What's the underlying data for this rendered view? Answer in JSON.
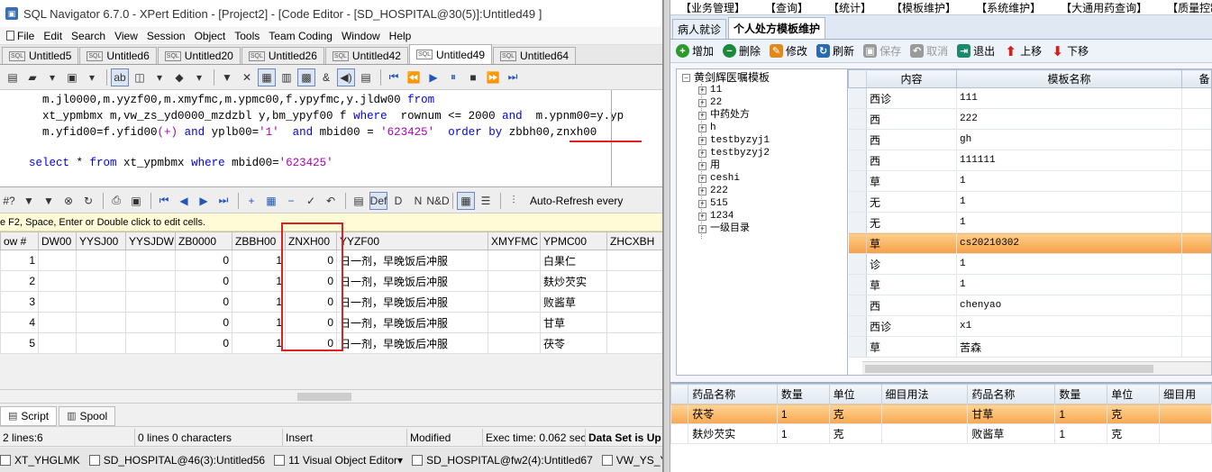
{
  "left": {
    "title": "SQL Navigator 6.7.0 - XPert Edition - [Project2] - [Code Editor - [SD_HOSPITAL@30(5)]:Untitled49 ]",
    "menu": [
      "File",
      "Edit",
      "Search",
      "View",
      "Session",
      "Object",
      "Tools",
      "Team Coding",
      "Window",
      "Help"
    ],
    "tabs": [
      "Untitled5",
      "Untitled6",
      "Untitled20",
      "Untitled26",
      "Untitled42",
      "Untitled49",
      "Untitled64"
    ],
    "active_tab": "Untitled49",
    "sql_lines": [
      "  m.jl0000,m.yyzf00,m.xmyfmc,m.ypmc00,f.ypyfmc,y.jldw00 from",
      "  xt_ypmbmx m,vw_zs_yd0000_mzdzbl y,bm_ypyf00 f where  rownum <= 2000 and  m.ypnm00=y.yp",
      "  m.yfid00=f.yfid00(+) and yplb00='1'  and mbid00 = '623425'  order by zbbh00,znxh00",
      "select * from xt_ypmbmx where mbid00='623425'"
    ],
    "auto_refresh": "Auto-Refresh every",
    "hint": "e F2, Space, Enter or Double click to edit cells.",
    "grid": {
      "headers": [
        "ow #",
        "DW00",
        "YYSJ00",
        "YYSJDW",
        "ZB0000",
        "ZBBH00",
        "ZNXH00",
        "YYZF00",
        "XMYFMC",
        "YPMC00",
        "ZHCXBH"
      ],
      "rows": [
        {
          "n": "1",
          "zb": "0",
          "zbbh": "1",
          "znxh": "0",
          "yyzf": "日一剂，早晚饭后冲服",
          "ypmc": "白果仁"
        },
        {
          "n": "2",
          "zb": "0",
          "zbbh": "1",
          "znxh": "0",
          "yyzf": "日一剂，早晚饭后冲服",
          "ypmc": "麸炒芡实"
        },
        {
          "n": "3",
          "zb": "0",
          "zbbh": "1",
          "znxh": "0",
          "yyzf": "日一剂，早晚饭后冲服",
          "ypmc": "败酱草"
        },
        {
          "n": "4",
          "zb": "0",
          "zbbh": "1",
          "znxh": "0",
          "yyzf": "日一剂，早晚饭后冲服",
          "ypmc": "甘草"
        },
        {
          "n": "5",
          "zb": "0",
          "zbbh": "1",
          "znxh": "0",
          "yyzf": "日一剂，早晚饭后冲服",
          "ypmc": "茯苓"
        }
      ]
    },
    "bottom_tabs": [
      "Script",
      "Spool"
    ],
    "status": [
      "2 lines:6",
      "0 lines 0 characters",
      "Insert",
      "Modified",
      "Exec time: 0.062 sec",
      "Data Set is Up"
    ],
    "taskbar": [
      "XT_YHGLMK",
      "SD_HOSPITAL@46(3):Untitled56",
      "11 Visual Object Editor",
      "SD_HOSPITAL@fw2(4):Untitled67",
      "VW_YS_YJCFHIST"
    ]
  },
  "right": {
    "menu": [
      "【业务管理】",
      "【查询】",
      "【统计】",
      "【模板维护】",
      "【系统维护】",
      "【大通用药查询】",
      "【质量控制"
    ],
    "tabs": [
      "病人就诊",
      "个人处方模板维护"
    ],
    "toolbar": [
      {
        "label": "增加",
        "icon": "add-icon",
        "color": "#2e9a2e"
      },
      {
        "label": "删除",
        "icon": "delete-icon",
        "color": "#1a8a3a"
      },
      {
        "label": "修改",
        "icon": "edit-icon",
        "color": "#e08a1a"
      },
      {
        "label": "刷新",
        "icon": "refresh-icon",
        "color": "#2a6ab0"
      },
      {
        "label": "保存",
        "icon": "save-icon",
        "color": "#8a8a8a"
      },
      {
        "label": "取消",
        "icon": "cancel-icon",
        "color": "#8a8a8a"
      },
      {
        "label": "退出",
        "icon": "exit-icon",
        "color": "#1a8a6a"
      },
      {
        "label": "上移",
        "icon": "up-arrow-icon",
        "color": "#d02020"
      },
      {
        "label": "下移",
        "icon": "down-arrow-icon",
        "color": "#d02020"
      }
    ],
    "tree": {
      "root": "黄剑辉医嘱模板",
      "children": [
        "11",
        "22",
        "中药处方",
        "h",
        "testbyzyj1",
        "testbyzyj2",
        "用",
        "ceshi",
        "222",
        "515",
        "1234",
        "一级目录"
      ]
    },
    "templates": {
      "headers": [
        "内容",
        "模板名称",
        "备"
      ],
      "rows": [
        {
          "content": "西诊",
          "name": "111"
        },
        {
          "content": "西",
          "name": "222"
        },
        {
          "content": "西",
          "name": "gh"
        },
        {
          "content": "西",
          "name": "111111"
        },
        {
          "content": "草",
          "name": "1"
        },
        {
          "content": "无",
          "name": "1"
        },
        {
          "content": "无",
          "name": "1"
        },
        {
          "content": "草",
          "name": "cs20210302"
        },
        {
          "content": "诊",
          "name": "1"
        },
        {
          "content": "草",
          "name": "1"
        },
        {
          "content": "西",
          "name": "chenyao"
        },
        {
          "content": "西诊",
          "name": "x1"
        },
        {
          "content": "草",
          "name": "苦森"
        }
      ],
      "selected_index": 7
    },
    "drugs": {
      "headers": [
        "药品名称",
        "数量",
        "单位",
        "细目用法",
        "药品名称",
        "数量",
        "单位",
        "细目用"
      ],
      "rows": [
        [
          "茯苓",
          "1",
          "克",
          "",
          "甘草",
          "1",
          "克",
          ""
        ],
        [
          "麸炒芡实",
          "1",
          "克",
          "",
          "败酱草",
          "1",
          "克",
          ""
        ]
      ]
    }
  }
}
